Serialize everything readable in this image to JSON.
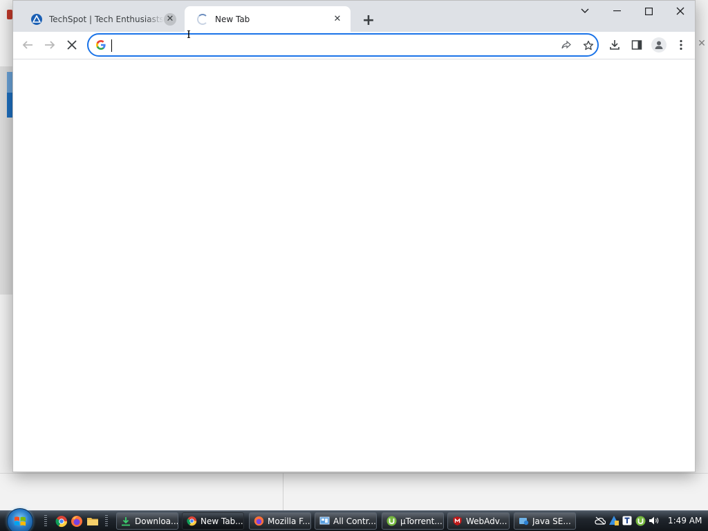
{
  "browser": {
    "tabs": [
      {
        "title": "TechSpot | Tech Enthusiasts, Power Users",
        "close": "✕"
      },
      {
        "title": "New Tab",
        "close": "✕"
      }
    ],
    "new_tab": "+",
    "window_controls": {
      "tab_search": "⌄",
      "minimize": "—",
      "maximize": "☐",
      "close": "✕"
    },
    "omnibox": {
      "value": "",
      "placeholder": ""
    },
    "icons": {
      "back": "arrow-left-icon",
      "forward": "arrow-right-icon",
      "stop": "close-icon",
      "share": "share-icon",
      "bookmark": "star-icon",
      "download": "download-icon",
      "side_panel": "side-panel-icon",
      "profile": "person-icon",
      "menu": "more-vertical-icon"
    }
  },
  "colors": {
    "accent": "#1a73e8",
    "tabstrip": "#dee1e6",
    "taskbar": "#1a1f25"
  },
  "taskbar": {
    "tasks": [
      {
        "label": "Downloa...",
        "icon": "download-manager-icon"
      },
      {
        "label": "New Tab...",
        "icon": "chrome-icon"
      },
      {
        "label": "Mozilla F...",
        "icon": "firefox-icon"
      },
      {
        "label": "All Contr...",
        "icon": "control-panel-icon"
      },
      {
        "label": "µTorrent...",
        "icon": "utorrent-icon"
      },
      {
        "label": "WebAdv...",
        "icon": "webadvisor-icon"
      },
      {
        "label": "Java SE...",
        "icon": "java-icon"
      }
    ],
    "clock": "1:49 AM"
  }
}
